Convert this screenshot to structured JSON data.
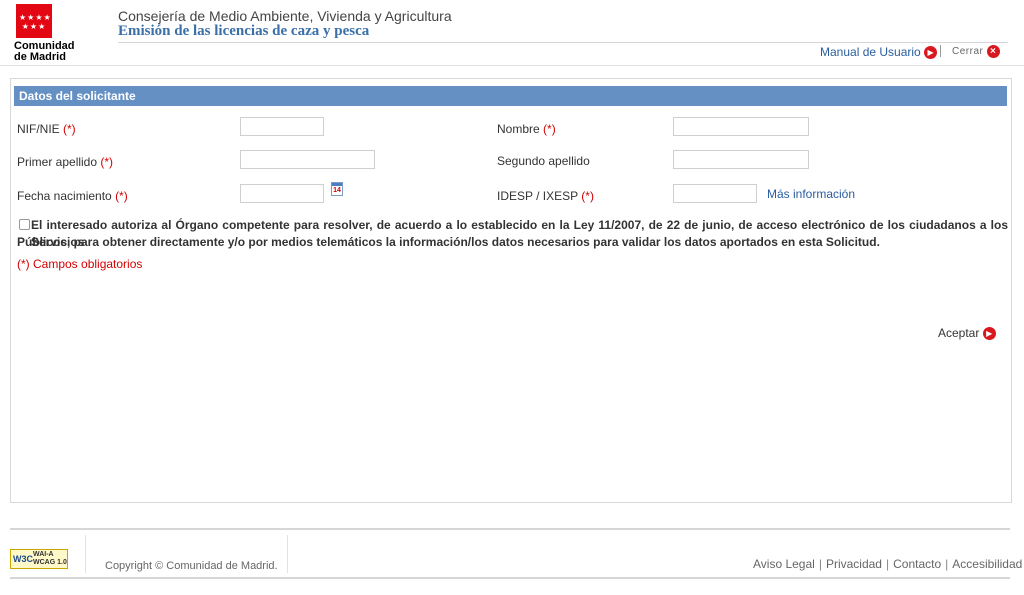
{
  "header": {
    "logo_text_line1": "Comunidad",
    "logo_text_line2": "de Madrid",
    "department": "Consejería de Medio Ambiente, Vivienda y Agricultura",
    "app_title": "Emisión de las licencias de caza y pesca",
    "manual_label": "Manual de Usuario",
    "close_label": "Cerrar"
  },
  "form": {
    "section_title": "Datos del solicitante",
    "required_mark": "(*)",
    "fields": {
      "nif_label": "NIF/NIE",
      "nombre_label": "Nombre",
      "primer_apellido_label": "Primer apellido",
      "segundo_apellido_label": "Segundo apellido",
      "fecha_label": "Fecha nacimiento",
      "idesp_label": "IDESP / IXESP"
    },
    "calendar_day": "14",
    "more_info_link": "Más información",
    "consent_line1": "El interesado autoriza al Órgano competente para resolver, de acuerdo a lo establecido en la Ley 11/2007, de 22 de junio, de acceso electrónico de los ciudadanos a los Servicios",
    "consent_line2": "Públicos, para obtener directamente y/o por medios telemáticos la información/los datos necesarios para validar los datos aportados en esta Solicitud.",
    "required_note": "(*) Campos obligatorios",
    "accept_label": "Aceptar"
  },
  "footer": {
    "wai_badge_w3c": "W3C",
    "wai_badge_line1": "WAI-A",
    "wai_badge_line2": "WCAG 1.0",
    "copyright": "Copyright © Comunidad de Madrid.",
    "links": [
      "Aviso Legal",
      "Privacidad",
      "Contacto",
      "Accesibilidad"
    ]
  },
  "colors": {
    "section_bar": "#6590c4",
    "brand_red": "#e30613",
    "link_blue": "#2a5d9f",
    "required_red": "#d40000"
  },
  "icons": [
    "madrid-flag-icon",
    "play-circle-icon",
    "close-circle-icon",
    "calendar-icon",
    "wai-a-badge-icon"
  ]
}
